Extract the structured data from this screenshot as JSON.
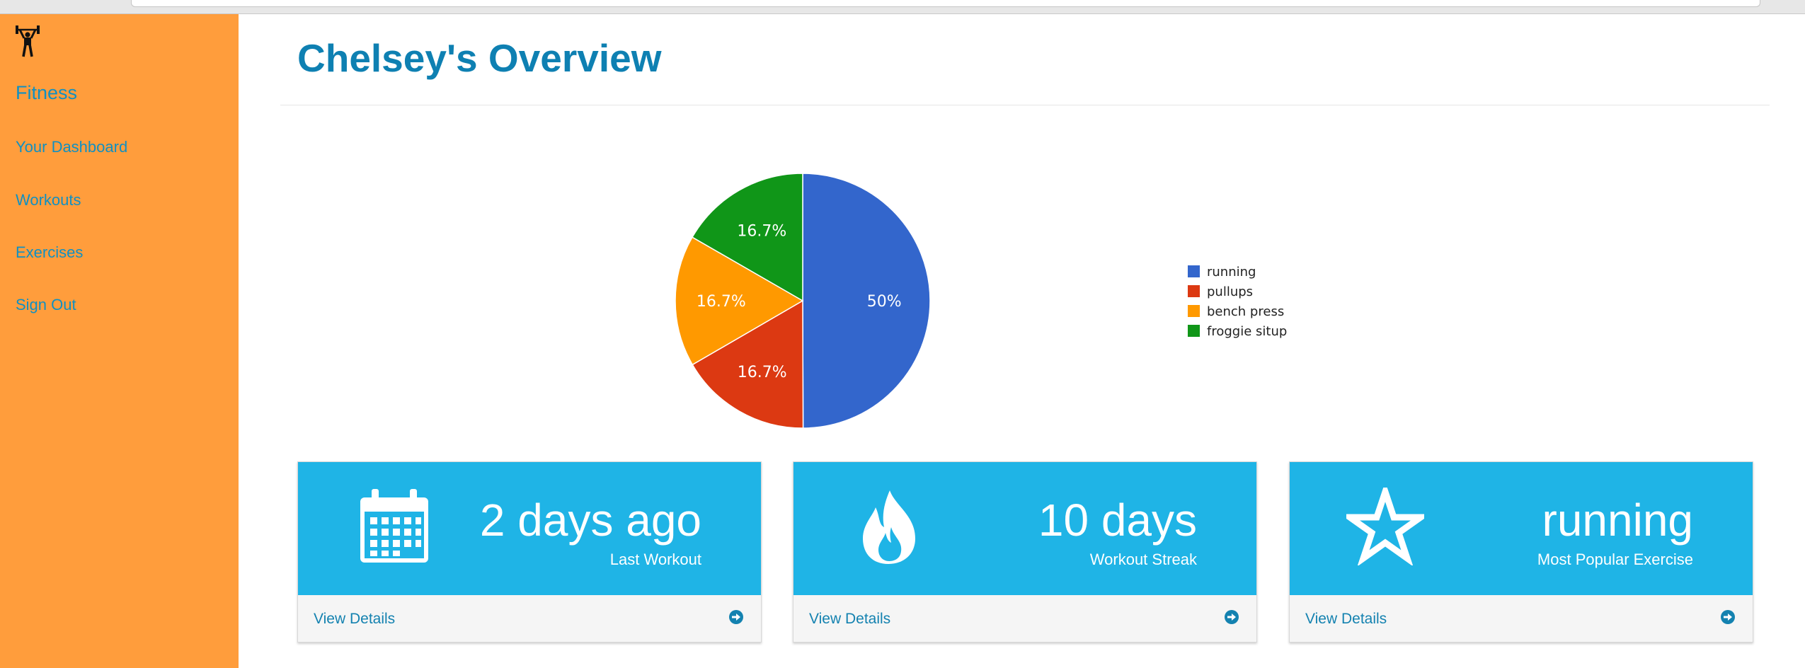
{
  "colors": {
    "sidebar_bg": "#ff9d3c",
    "link": "#1090c2",
    "title": "#0e80b2",
    "panel_head": "#1fb4e6",
    "panel_foot": "#f5f5f5"
  },
  "sidebar": {
    "logo_icon": "weightlifter-icon",
    "brand": "Fitness",
    "items": [
      {
        "label": "Your Dashboard"
      },
      {
        "label": "Workouts"
      },
      {
        "label": "Exercises"
      },
      {
        "label": "Sign Out"
      }
    ]
  },
  "main": {
    "title": "Chelsey's Overview"
  },
  "chart_data": {
    "type": "pie",
    "categories": [
      "running",
      "pullups",
      "bench press",
      "froggie situp"
    ],
    "values": [
      50,
      16.7,
      16.7,
      16.7
    ],
    "labels": [
      "50%",
      "16.7%",
      "16.7%",
      "16.7%"
    ],
    "colors": [
      "#3366cc",
      "#dc3912",
      "#ff9900",
      "#109618"
    ],
    "legend": "right"
  },
  "panels": [
    {
      "icon": "calendar-icon",
      "value": "2 days ago",
      "caption": "Last Workout",
      "link": "View Details",
      "arrow": "circle-arrow-right-icon"
    },
    {
      "icon": "fire-icon",
      "value": "10 days",
      "caption": "Workout Streak",
      "link": "View Details",
      "arrow": "circle-arrow-right-icon"
    },
    {
      "icon": "star-icon",
      "value": "running",
      "caption": "Most Popular Exercise",
      "link": "View Details",
      "arrow": "circle-arrow-right-icon"
    }
  ]
}
